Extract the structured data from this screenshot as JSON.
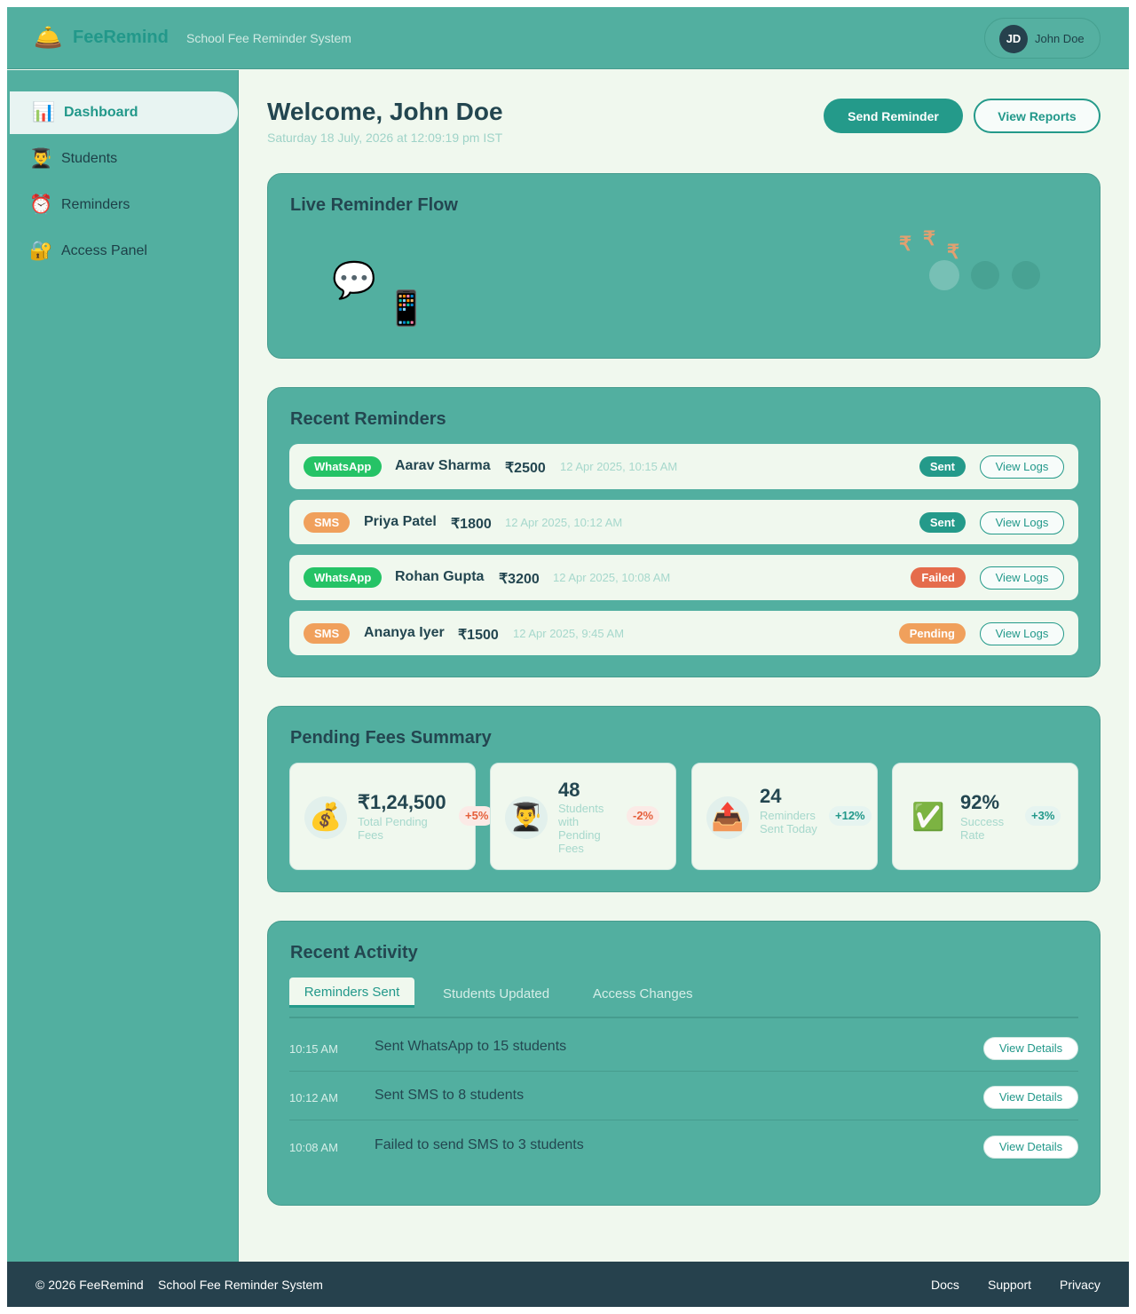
{
  "header": {
    "brand_icon": "bell-icon",
    "brand_name": "FeeRemind",
    "tagline": "School Fee Reminder System",
    "user_initials": "JD",
    "user_name": "John Doe"
  },
  "sidebar": {
    "items": [
      {
        "icon": "📊",
        "label": "Dashboard",
        "active": true
      },
      {
        "icon": "👨‍🎓",
        "label": "Students"
      },
      {
        "icon": "⏰",
        "label": "Reminders"
      },
      {
        "icon": "🔐",
        "label": "Access Panel"
      }
    ]
  },
  "main": {
    "welcome": "Welcome, John Doe",
    "datetime": "Saturday 18 July, 2026 at 12:09:19 pm IST",
    "send_reminder": "Send Reminder",
    "view_reports": "View Reports"
  },
  "flow": {
    "title": "Live Reminder Flow",
    "chat_icon": "💬",
    "phone_icon": "📱",
    "rupee": "₹"
  },
  "reminders": {
    "title": "Recent Reminders",
    "view_logs": "View Logs",
    "rows": [
      {
        "channel": "WhatsApp",
        "name": "Aarav Sharma",
        "amount": "₹2500",
        "time": "12 Apr 2025, 10:15 AM",
        "status": "Sent"
      },
      {
        "channel": "SMS",
        "name": "Priya Patel",
        "amount": "₹1800",
        "time": "12 Apr 2025, 10:12 AM",
        "status": "Sent"
      },
      {
        "channel": "WhatsApp",
        "name": "Rohan Gupta",
        "amount": "₹3200",
        "time": "12 Apr 2025, 10:08 AM",
        "status": "Failed"
      },
      {
        "channel": "SMS",
        "name": "Ananya Iyer",
        "amount": "₹1500",
        "time": "12 Apr 2025, 9:45 AM",
        "status": "Pending"
      }
    ]
  },
  "summary": {
    "title": "Pending Fees Summary",
    "stats": [
      {
        "icon": "💰",
        "value": "₹1,24,500",
        "label": "Total Pending Fees",
        "trend": "+5%"
      },
      {
        "icon": "👨‍🎓",
        "value": "48",
        "label": "Students with Pending Fees",
        "trend": "-2%"
      },
      {
        "icon": "📤",
        "value": "24",
        "label": "Reminders Sent Today",
        "trend": "+12%"
      },
      {
        "icon": "✅",
        "value": "92%",
        "label": "Success Rate",
        "trend": "+3%"
      }
    ]
  },
  "activity": {
    "title": "Recent Activity",
    "tabs": [
      "Reminders Sent",
      "Students Updated",
      "Access Changes"
    ],
    "view_details": "View Details",
    "rows": [
      {
        "time": "10:15 AM",
        "text": "Sent WhatsApp to 15 students"
      },
      {
        "time": "10:12 AM",
        "text": "Sent SMS to 8 students"
      },
      {
        "time": "10:08 AM",
        "text": "Failed to send SMS to 3 students"
      }
    ]
  },
  "footer": {
    "copyright": "© 2026 FeeRemind",
    "tagline": "School Fee Reminder System",
    "links": [
      "Docs",
      "Support",
      "Privacy"
    ]
  },
  "colors": {
    "primary": "#249a8a",
    "panel": "#52afa0",
    "background": "#f0f8ee",
    "whatsapp": "#25c366",
    "sms": "#f0a05c",
    "failed": "#e56c4c",
    "footer": "#26414d"
  }
}
